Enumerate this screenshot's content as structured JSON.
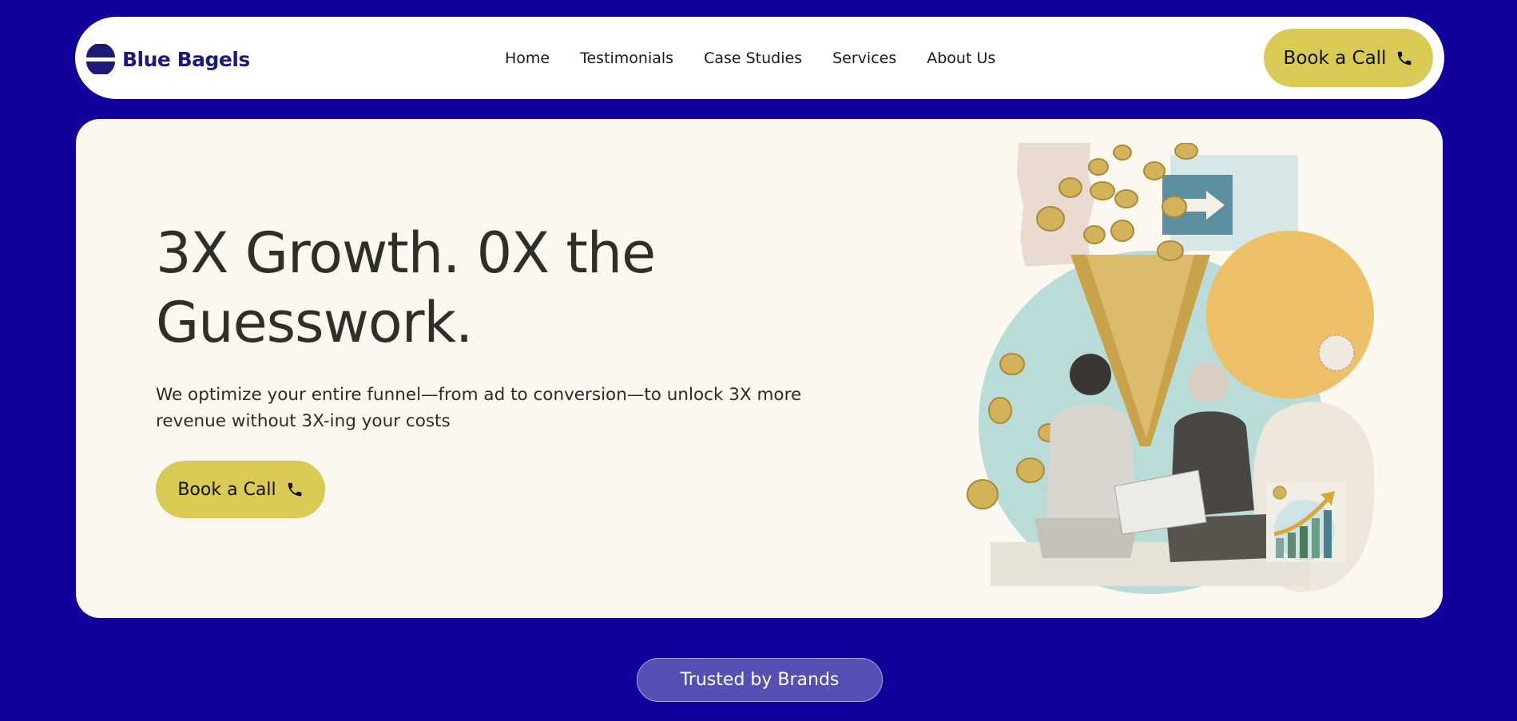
{
  "brand": {
    "name": "Blue Bagels",
    "logo_icon": "half-sun-bagel-icon",
    "logo_color": "#1d1b78"
  },
  "nav": {
    "items": [
      "Home",
      "Testimonials",
      "Case Studies",
      "Services",
      "About Us"
    ],
    "cta_label": "Book a Call",
    "cta_icon": "phone-icon"
  },
  "hero": {
    "title": "3X Growth. 0X the Guesswork.",
    "description": "We optimize your entire funnel—from ad to conversion—to unlock 3X more revenue without 3X-ing your costs",
    "cta_label": "Book a Call",
    "cta_icon": "phone-icon",
    "illustration": "collage-funnel-coins-businessmen-chart"
  },
  "trusted": {
    "label": "Trusted by Brands"
  },
  "colors": {
    "page_background": "#12009c",
    "nav_background": "#ffffff",
    "hero_background": "#fdf8ef",
    "accent_yellow": "#d9c955",
    "pill_purple": "#5650b4",
    "heading_text": "#2e2e2a"
  }
}
